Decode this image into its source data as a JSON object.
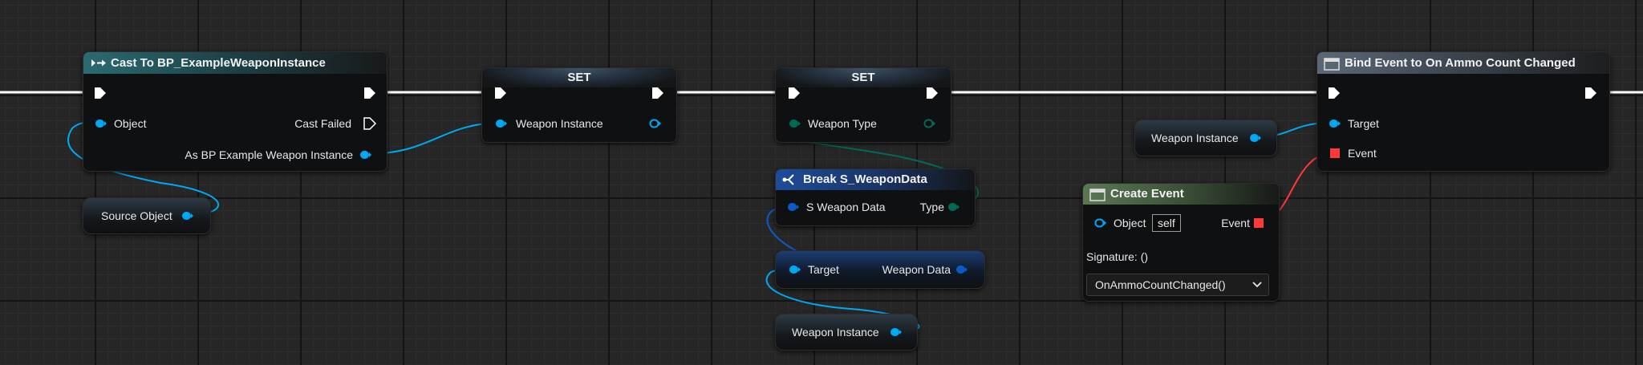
{
  "nodes": {
    "cast": {
      "title": "Cast To BP_ExampleWeaponInstance",
      "object_pin": "Object",
      "cast_failed_pin": "Cast Failed",
      "as_pin": "As BP Example Weapon Instance"
    },
    "set1": {
      "title": "SET",
      "pin": "Weapon Instance"
    },
    "set2": {
      "title": "SET",
      "pin": "Weapon Type"
    },
    "break": {
      "title": "Break S_WeaponData",
      "input_pin": "S Weapon Data",
      "output_pin": "Type"
    },
    "getter": {
      "input_pin": "Target",
      "output_pin": "Weapon Data"
    },
    "weapon_instance_var": {
      "label": "Weapon Instance"
    },
    "weapon_instance_var2": {
      "label": "Weapon Instance"
    },
    "source_object_var": {
      "label": "Source Object"
    },
    "create_event": {
      "title": "Create Event",
      "object_pin": "Object",
      "object_value": "self",
      "event_pin": "Event",
      "signature": "Signature: ()",
      "function": "OnAmmoCountChanged()"
    },
    "bind": {
      "title": "Bind Event to On Ammo Count Changed",
      "target_pin": "Target",
      "event_pin": "Event"
    }
  },
  "colors": {
    "exec": "#ffffff",
    "object_pin": "#00a8f4",
    "byte_pin": "#006a55",
    "struct_pin": "#0a5bc8",
    "delegate_pin": "#ff3838",
    "cast_header": "#2b6b72",
    "function_header": "#5b6977",
    "break_header": "#1e4c9a",
    "create_event_header": "#5a7754"
  },
  "icons": {
    "cast": "cast-arrows-icon",
    "function": "function-icon",
    "break": "break-struct-icon",
    "exec_in": "exec-pin-icon",
    "exec_out": "exec-pin-icon",
    "data": "data-pin-icon",
    "delegate": "delegate-pin-icon",
    "dropdown": "chevron-down-icon"
  }
}
